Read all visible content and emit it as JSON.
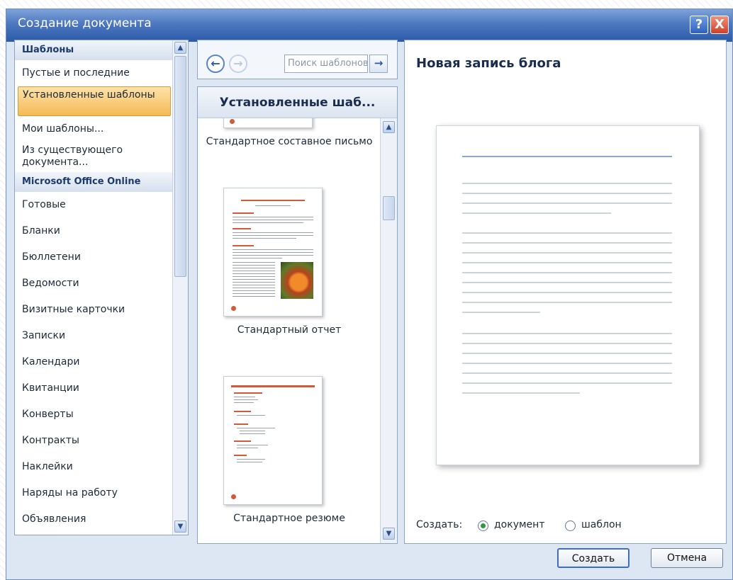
{
  "window": {
    "title": "Создание документа",
    "help_label": "?",
    "close_label": "X"
  },
  "left": {
    "templates_header": "Шаблоны",
    "templates_items": [
      "Пустые и последние",
      "Установленные шаблоны",
      "Мои шаблоны...",
      "Из существующего документа..."
    ],
    "selected_index": 1,
    "online_header": "Microsoft Office Online",
    "online_items": [
      "Готовые",
      "Бланки",
      "Бюллетени",
      "Ведомости",
      "Визитные карточки",
      "Записки",
      "Календари",
      "Квитанции",
      "Конверты",
      "Контракты",
      "Наклейки",
      "Наряды на работу",
      "Объявления"
    ]
  },
  "middle": {
    "search_placeholder": "Поиск шаблонов",
    "header": "Установленные шаб...",
    "templates": [
      "Стандартное составное письмо",
      "Стандартный отчет",
      "Стандартное резюме"
    ]
  },
  "right": {
    "preview_title": "Новая запись блога",
    "create_label": "Создать:",
    "radio_document": "документ",
    "radio_template": "шаблон",
    "selected_radio": "document"
  },
  "buttons": {
    "create": "Создать",
    "cancel": "Отмена"
  },
  "icons": {
    "back": "←",
    "forward": "→",
    "search_go": "→",
    "scroll_up": "▲",
    "scroll_down": "▼"
  },
  "colors": {
    "title_bar": "#2c5aa8",
    "selected_item": "#f5b955",
    "accent_red": "#d05a3a"
  }
}
